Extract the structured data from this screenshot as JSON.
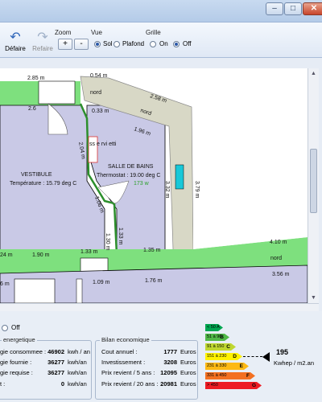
{
  "window": {
    "min_glyph": "–",
    "max_glyph": "□",
    "close_glyph": "✕"
  },
  "toolbar": {
    "undo_label": "Défaire",
    "redo_label": "Refaire",
    "zoom_group": "Zoom",
    "zoom_in": "+",
    "zoom_out": "-",
    "view_group": "Vue",
    "view_options": [
      "Sol",
      "Plafond"
    ],
    "view_selected": "Sol",
    "grid_group": "Grille",
    "grid_options": [
      "On",
      "Off"
    ],
    "grid_selected": "Off"
  },
  "plan": {
    "dimensions": [
      "2.85 m",
      "0.54 m",
      "2.58 m",
      "2.6",
      "0.33 m",
      "1.96 m",
      "2.04 m",
      "3.32 m",
      "3.79 m",
      "1.06 m",
      "1.33 m",
      "1.30 m",
      "1.33 m",
      "1.35 m",
      "4.10 m",
      "24 m",
      "1.90 m",
      "1.09 m",
      "1.76 m",
      "3.56 m",
      "6 m"
    ],
    "rooms": [
      {
        "name": "VESTIBULE",
        "temperature": "Température   : 15.79 deg C"
      },
      {
        "name": "SALLE DE BAINS",
        "temperature": "Thermostat  : 19.00 deg C"
      }
    ],
    "corridor_labels": [
      "nord",
      "nord",
      "nord",
      "nord"
    ],
    "wall_label": "ss e rvi etti",
    "green_label": "173 w",
    "colors": {
      "room": "#c9c9e6",
      "exterior_wall": "#7ee07e",
      "corridor": "#d8d8c6",
      "window": "#18c8d8"
    }
  },
  "bottom": {
    "off_label": "Off",
    "energy": {
      "title": "energetique",
      "rows": [
        {
          "label": "gie consommee :",
          "value": "46902",
          "unit": "kwh / an"
        },
        {
          "label": "gie fournie :",
          "value": "36277",
          "unit": "kwh/an"
        },
        {
          "label": "gie requise :",
          "value": "36277",
          "unit": "kwh/an"
        },
        {
          "label": "t :",
          "value": "0",
          "unit": "kwh/an"
        }
      ]
    },
    "economic": {
      "title": "Bilan economique",
      "rows": [
        {
          "label": "Cout annuel :",
          "value": "1777",
          "unit": "Euros"
        },
        {
          "label": "Investissement :",
          "value": "3208",
          "unit": "Euros"
        },
        {
          "label": "Prix revient / 5 ans :",
          "value": "12095",
          "unit": "Euros"
        },
        {
          "label": "Prix revient / 20 ans :",
          "value": "20981",
          "unit": "Euros"
        }
      ]
    },
    "energy_label": {
      "classes": [
        {
          "letter": "A",
          "range": "< 50 A",
          "color": "#00a651"
        },
        {
          "letter": "B",
          "range": "51 à 90",
          "color": "#50b848"
        },
        {
          "letter": "C",
          "range": "91 à 150",
          "color": "#bfd730"
        },
        {
          "letter": "D",
          "range": "151 à 230",
          "color": "#fff200"
        },
        {
          "letter": "E",
          "range": "231 à 330",
          "color": "#fdb913"
        },
        {
          "letter": "F",
          "range": "331 à 450",
          "color": "#f37021"
        },
        {
          "letter": "G",
          "range": "> 450",
          "color": "#ed1c24"
        }
      ],
      "value": "195",
      "unit": "Kwhep / m2.an",
      "current_class": "D"
    }
  }
}
